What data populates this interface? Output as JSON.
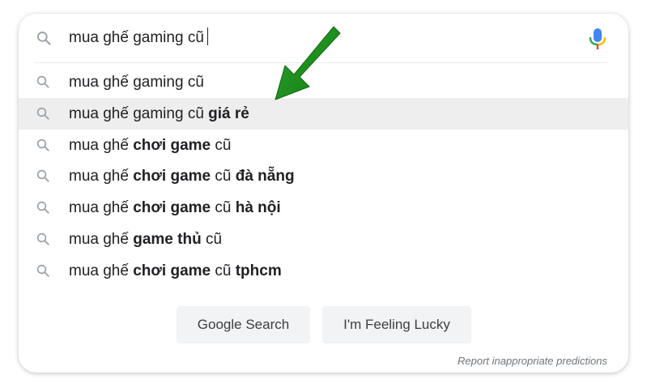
{
  "search": {
    "query": "mua ghế gaming cũ"
  },
  "suggestions": [
    {
      "parts": [
        {
          "t": "mua ghế gaming cũ",
          "b": false
        }
      ],
      "highlighted": false
    },
    {
      "parts": [
        {
          "t": "mua ghế gaming cũ ",
          "b": false
        },
        {
          "t": "giá rẻ",
          "b": true
        }
      ],
      "highlighted": true
    },
    {
      "parts": [
        {
          "t": "mua ghế ",
          "b": false
        },
        {
          "t": "chơi game",
          "b": true
        },
        {
          "t": " cũ",
          "b": false
        }
      ],
      "highlighted": false
    },
    {
      "parts": [
        {
          "t": "mua ghế ",
          "b": false
        },
        {
          "t": "chơi game",
          "b": true
        },
        {
          "t": " cũ ",
          "b": false
        },
        {
          "t": "đà nẵng",
          "b": true
        }
      ],
      "highlighted": false
    },
    {
      "parts": [
        {
          "t": "mua ghế ",
          "b": false
        },
        {
          "t": "chơi game",
          "b": true
        },
        {
          "t": " cũ ",
          "b": false
        },
        {
          "t": "hà nội",
          "b": true
        }
      ],
      "highlighted": false
    },
    {
      "parts": [
        {
          "t": "mua ghế ",
          "b": false
        },
        {
          "t": "game thủ",
          "b": true
        },
        {
          "t": " cũ",
          "b": false
        }
      ],
      "highlighted": false
    },
    {
      "parts": [
        {
          "t": "mua ghế ",
          "b": false
        },
        {
          "t": "chơi game",
          "b": true
        },
        {
          "t": " cũ ",
          "b": false
        },
        {
          "t": "tphcm",
          "b": true
        }
      ],
      "highlighted": false
    }
  ],
  "buttons": {
    "search_label": "Google Search",
    "lucky_label": "I'm Feeling Lucky"
  },
  "report_text": "Report inappropriate predictions",
  "icons": {
    "search": "search-icon",
    "mic": "microphone-icon",
    "annotation": "green-arrow-icon"
  },
  "colors": {
    "highlight_bg": "#eeeeee",
    "button_bg": "#f1f3f4",
    "arrow_green": "#1f8a1f",
    "mic_blue": "#4285f4",
    "mic_red": "#ea4335",
    "mic_yellow": "#fbbc04",
    "mic_green": "#34a853"
  }
}
